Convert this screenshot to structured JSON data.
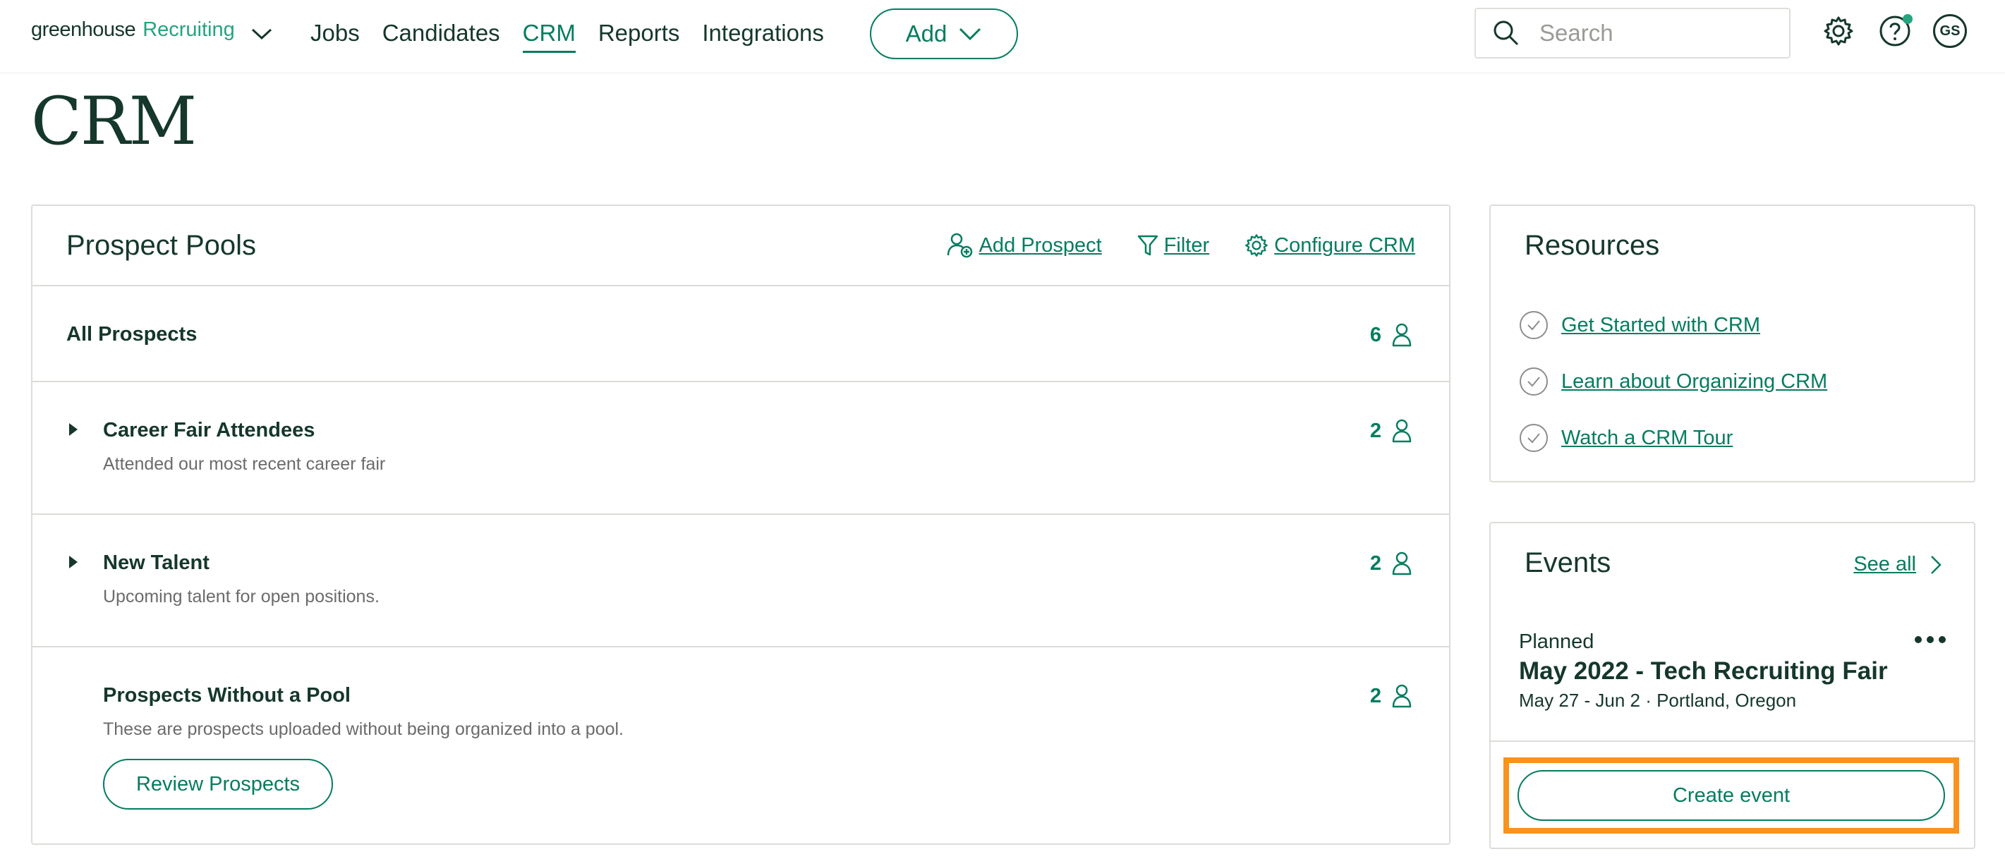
{
  "header": {
    "logo_main": "greenhouse",
    "logo_product": "Recruiting",
    "nav": [
      {
        "label": "Jobs"
      },
      {
        "label": "Candidates"
      },
      {
        "label": "CRM"
      },
      {
        "label": "Reports"
      },
      {
        "label": "Integrations"
      }
    ],
    "active_nav": "CRM",
    "add_label": "Add",
    "search_placeholder": "Search",
    "avatar_initials": "GS"
  },
  "page": {
    "title": "CRM"
  },
  "prospect_pools": {
    "title": "Prospect Pools",
    "actions": {
      "add_prospect": "Add Prospect",
      "filter": "Filter",
      "configure": "Configure CRM"
    },
    "rows": [
      {
        "name": "All Prospects",
        "description": "",
        "count": "6"
      },
      {
        "name": "Career Fair Attendees",
        "description": "Attended our most recent career fair",
        "count": "2"
      },
      {
        "name": "New Talent",
        "description": "Upcoming talent for open positions.",
        "count": "2"
      },
      {
        "name": "Prospects Without a Pool",
        "description": "These are prospects uploaded without being organized into a pool.",
        "count": "2"
      }
    ],
    "review_button": "Review Prospects"
  },
  "resources": {
    "title": "Resources",
    "items": [
      {
        "label": "Get Started with CRM"
      },
      {
        "label": "Learn about Organizing CRM"
      },
      {
        "label": "Watch a CRM Tour"
      }
    ]
  },
  "events": {
    "title": "Events",
    "see_all": "See all",
    "event": {
      "status": "Planned",
      "name": "May 2022 - Tech Recruiting Fair",
      "meta": "May 27 - Jun 2 · Portland, Oregon"
    },
    "create_button": "Create event"
  },
  "colors": {
    "brand": "#047d5f",
    "accent_highlight": "#f7931e",
    "text": "#15372c"
  }
}
